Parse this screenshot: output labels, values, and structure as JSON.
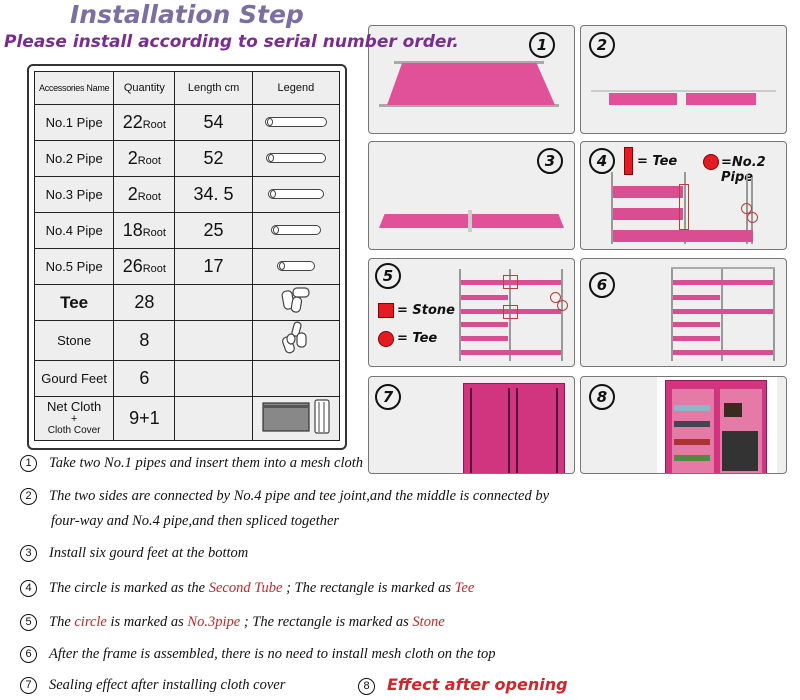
{
  "header": {
    "title": "Installation Step",
    "subtitle": "Please install according to serial number order."
  },
  "table": {
    "columns": [
      "Accessories Name",
      "Quantity",
      "Length cm",
      "Legend"
    ],
    "rows": [
      {
        "name": "No.1 Pipe",
        "qty": "22",
        "unit": "Root",
        "length": "54",
        "legend": "pipe-icon"
      },
      {
        "name": "No.2 Pipe",
        "qty": "2",
        "unit": "Root",
        "length": "52",
        "legend": "pipe-icon"
      },
      {
        "name": "No.3 Pipe",
        "qty": "2",
        "unit": "Root",
        "length": "34. 5",
        "legend": "pipe-icon"
      },
      {
        "name": "No.4 Pipe",
        "qty": "18",
        "unit": "Root",
        "length": "25",
        "legend": "pipe-icon"
      },
      {
        "name": "No.5 Pipe",
        "qty": "26",
        "unit": "Root",
        "length": "17",
        "legend": "pipe-icon"
      },
      {
        "name": "Tee",
        "qty": "28",
        "unit": "",
        "length": "",
        "legend": "tee-connector-icon"
      },
      {
        "name": "Stone",
        "qty": "8",
        "unit": "",
        "length": "",
        "legend": "stone-connector-icon"
      },
      {
        "name": "Gourd Feet",
        "qty": "6",
        "unit": "",
        "length": "",
        "legend": ""
      },
      {
        "name": "Net Cloth",
        "name_plus": "+",
        "name2": "Cloth Cover",
        "qty": "9+1",
        "unit": "",
        "length": "",
        "legend": "cloth-icon"
      }
    ]
  },
  "panels": [
    {
      "number": "1"
    },
    {
      "number": "2"
    },
    {
      "number": "3"
    },
    {
      "number": "4",
      "legend_rect": "= Tee",
      "legend_dot": "=No.2 Pipe"
    },
    {
      "number": "5",
      "legend_rect": "= Stone",
      "legend_dot": "= Tee"
    },
    {
      "number": "6"
    },
    {
      "number": "7"
    },
    {
      "number": "8"
    }
  ],
  "steps": [
    {
      "n": "1",
      "text": "Take two No.1 pipes and insert them into a mesh cloth"
    },
    {
      "n": "2",
      "text": "The two sides are connected by No.4 pipe and tee joint,and the middle is connected by",
      "text2": "four-way and No.4 pipe,and then spliced together"
    },
    {
      "n": "3",
      "text": "Install six gourd feet at the bottom"
    },
    {
      "n": "4",
      "pre": "The circle is marked as the ",
      "hl1": "Second Tube",
      "mid": " ; The rectangle is marked as ",
      "hl2": "Tee"
    },
    {
      "n": "5",
      "pre": "The ",
      "hl1": "circle",
      "mid": " is marked as ",
      "hl2": "No.3pipe",
      "mid2": " ; The rectangle is marked as ",
      "hl3": "Stone"
    },
    {
      "n": "6",
      "text": "After the frame is assembled, there is no need to install mesh cloth on the top"
    },
    {
      "n": "7",
      "text": "Sealing effect after installing cloth cover"
    },
    {
      "n": "8",
      "text": "Effect after opening"
    }
  ],
  "colors": {
    "title": "#7b6fa0",
    "subtitle": "#7a2c91",
    "pink": "#e0519a",
    "highlight": "#c0282d"
  }
}
